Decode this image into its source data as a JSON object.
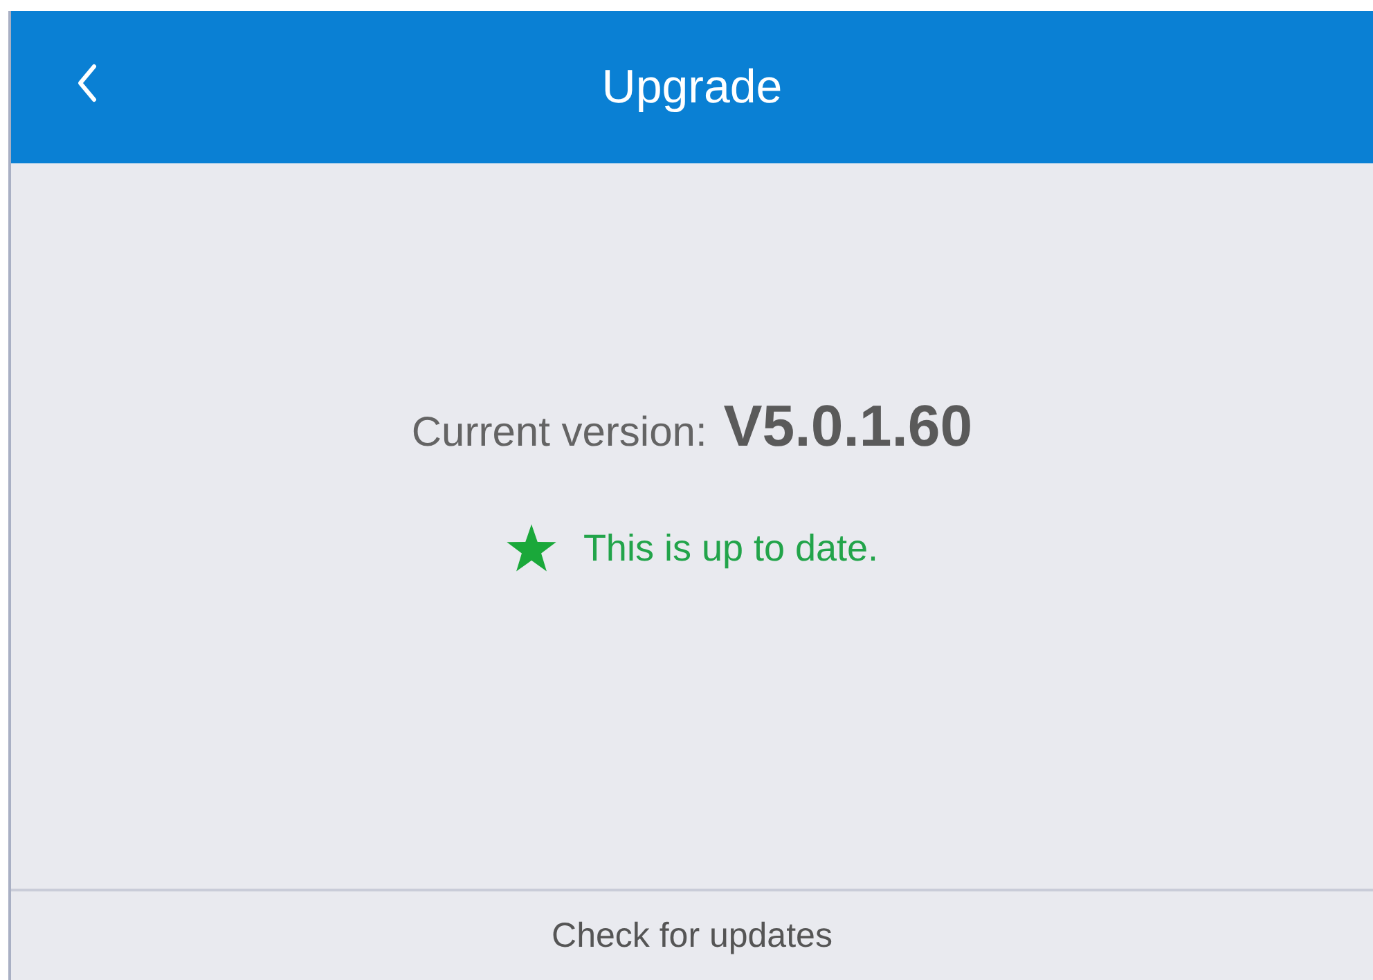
{
  "header": {
    "title": "Upgrade"
  },
  "version": {
    "label": "Current version:",
    "value": "V5.0.1.60"
  },
  "status": {
    "kind": "up_to_date",
    "text": "This is up to date."
  },
  "footer": {
    "button": "Check for updates"
  }
}
